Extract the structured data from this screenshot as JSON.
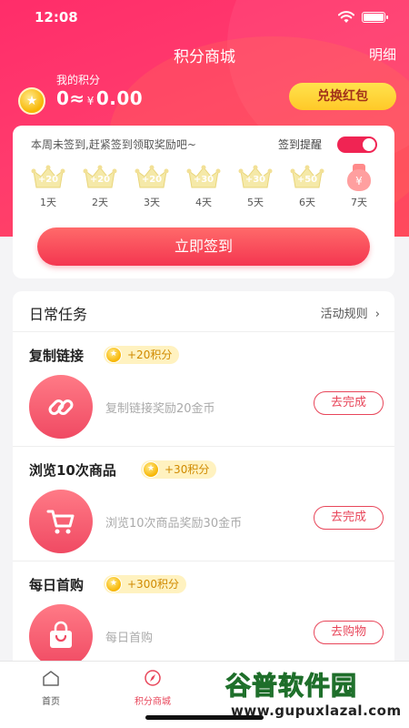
{
  "status_bar": {
    "time": "12:08"
  },
  "nav": {
    "title": "积分商城",
    "detail_label": "明细"
  },
  "points": {
    "label": "我的积分",
    "value": "0≈",
    "currency_symbol": "¥",
    "money": "0.00"
  },
  "redeem_button": "兑换红包",
  "checkin": {
    "hint": "本周未签到,赶紧签到领取奖励吧~",
    "remind_label": "签到提醒",
    "remind_on": true,
    "days": [
      {
        "label": "1天",
        "reward": "+20"
      },
      {
        "label": "2天",
        "reward": "+20"
      },
      {
        "label": "3天",
        "reward": "+20"
      },
      {
        "label": "4天",
        "reward": "+30"
      },
      {
        "label": "5天",
        "reward": "+30"
      },
      {
        "label": "6天",
        "reward": "+50"
      },
      {
        "label": "7天",
        "reward": "¥"
      }
    ],
    "button": "立即签到"
  },
  "tasks": {
    "title": "日常任务",
    "rules_link": "活动规则",
    "items": [
      {
        "name": "复制链接",
        "reward": "+20积分",
        "description": "复制链接奖励20金币",
        "action": "去完成",
        "icon": "link-icon"
      },
      {
        "name": "浏览10次商品",
        "reward": "+30积分",
        "description": "浏览10次商品奖励30金币",
        "action": "去完成",
        "icon": "cart-icon"
      },
      {
        "name": "每日首购",
        "reward": "+300积分",
        "description": "每日首购",
        "action": "去购物",
        "icon": "shopping-bag-icon"
      }
    ]
  },
  "tabbar": [
    {
      "label": "首页",
      "icon": "home-icon",
      "active": false
    },
    {
      "label": "积分商城",
      "icon": "compass-icon",
      "active": true
    }
  ],
  "watermark": {
    "title": "谷普软件园",
    "url": "www.gupuxlazal.com"
  },
  "colors": {
    "brand": "#ff2d6a",
    "accent": "#e8465a",
    "gold": "#ffc928"
  }
}
